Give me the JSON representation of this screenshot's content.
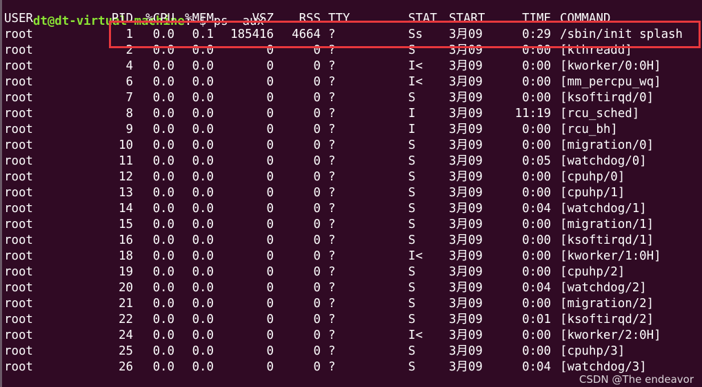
{
  "prompt": {
    "user_host": "dt@dt-virtual-machine",
    "path_sep": ":",
    "path": "~",
    "symbol": "$",
    "command": "ps -aux"
  },
  "columns": [
    "USER",
    "PID",
    "%CPU",
    "%MEM",
    "VSZ",
    "RSS",
    "TTY",
    "STAT",
    "START",
    "TIME",
    "COMMAND"
  ],
  "rows": [
    [
      "root",
      "1",
      "0.0",
      "0.1",
      "185416",
      "4664",
      "?",
      "Ss",
      "3月09",
      "0:29",
      "/sbin/init splash"
    ],
    [
      "root",
      "2",
      "0.0",
      "0.0",
      "0",
      "0",
      "?",
      "S",
      "3月09",
      "0:00",
      "[kthreadd]"
    ],
    [
      "root",
      "4",
      "0.0",
      "0.0",
      "0",
      "0",
      "?",
      "I<",
      "3月09",
      "0:00",
      "[kworker/0:0H]"
    ],
    [
      "root",
      "6",
      "0.0",
      "0.0",
      "0",
      "0",
      "?",
      "I<",
      "3月09",
      "0:00",
      "[mm_percpu_wq]"
    ],
    [
      "root",
      "7",
      "0.0",
      "0.0",
      "0",
      "0",
      "?",
      "S",
      "3月09",
      "0:00",
      "[ksoftirqd/0]"
    ],
    [
      "root",
      "8",
      "0.0",
      "0.0",
      "0",
      "0",
      "?",
      "I",
      "3月09",
      "11:19",
      "[rcu_sched]"
    ],
    [
      "root",
      "9",
      "0.0",
      "0.0",
      "0",
      "0",
      "?",
      "I",
      "3月09",
      "0:00",
      "[rcu_bh]"
    ],
    [
      "root",
      "10",
      "0.0",
      "0.0",
      "0",
      "0",
      "?",
      "S",
      "3月09",
      "0:00",
      "[migration/0]"
    ],
    [
      "root",
      "11",
      "0.0",
      "0.0",
      "0",
      "0",
      "?",
      "S",
      "3月09",
      "0:05",
      "[watchdog/0]"
    ],
    [
      "root",
      "12",
      "0.0",
      "0.0",
      "0",
      "0",
      "?",
      "S",
      "3月09",
      "0:00",
      "[cpuhp/0]"
    ],
    [
      "root",
      "13",
      "0.0",
      "0.0",
      "0",
      "0",
      "?",
      "S",
      "3月09",
      "0:00",
      "[cpuhp/1]"
    ],
    [
      "root",
      "14",
      "0.0",
      "0.0",
      "0",
      "0",
      "?",
      "S",
      "3月09",
      "0:04",
      "[watchdog/1]"
    ],
    [
      "root",
      "15",
      "0.0",
      "0.0",
      "0",
      "0",
      "?",
      "S",
      "3月09",
      "0:00",
      "[migration/1]"
    ],
    [
      "root",
      "16",
      "0.0",
      "0.0",
      "0",
      "0",
      "?",
      "S",
      "3月09",
      "0:00",
      "[ksoftirqd/1]"
    ],
    [
      "root",
      "18",
      "0.0",
      "0.0",
      "0",
      "0",
      "?",
      "I<",
      "3月09",
      "0:00",
      "[kworker/1:0H]"
    ],
    [
      "root",
      "19",
      "0.0",
      "0.0",
      "0",
      "0",
      "?",
      "S",
      "3月09",
      "0:00",
      "[cpuhp/2]"
    ],
    [
      "root",
      "20",
      "0.0",
      "0.0",
      "0",
      "0",
      "?",
      "S",
      "3月09",
      "0:04",
      "[watchdog/2]"
    ],
    [
      "root",
      "21",
      "0.0",
      "0.0",
      "0",
      "0",
      "?",
      "S",
      "3月09",
      "0:00",
      "[migration/2]"
    ],
    [
      "root",
      "22",
      "0.0",
      "0.0",
      "0",
      "0",
      "?",
      "S",
      "3月09",
      "0:01",
      "[ksoftirqd/2]"
    ],
    [
      "root",
      "24",
      "0.0",
      "0.0",
      "0",
      "0",
      "?",
      "I<",
      "3月09",
      "0:00",
      "[kworker/2:0H]"
    ],
    [
      "root",
      "25",
      "0.0",
      "0.0",
      "0",
      "0",
      "?",
      "S",
      "3月09",
      "0:00",
      "[cpuhp/3]"
    ],
    [
      "root",
      "26",
      "0.0",
      "0.0",
      "0",
      "0",
      "?",
      "S",
      "3月09",
      "0:04",
      "[watchdog/3]"
    ]
  ],
  "highlighted_row": 0,
  "watermark": "CSDN @The endeavor",
  "colors": {
    "background": "#300a24",
    "prompt_user": "#8ae234",
    "prompt_path": "#729fcf",
    "highlight_box": "#e8383d",
    "text": "#ffffff"
  }
}
